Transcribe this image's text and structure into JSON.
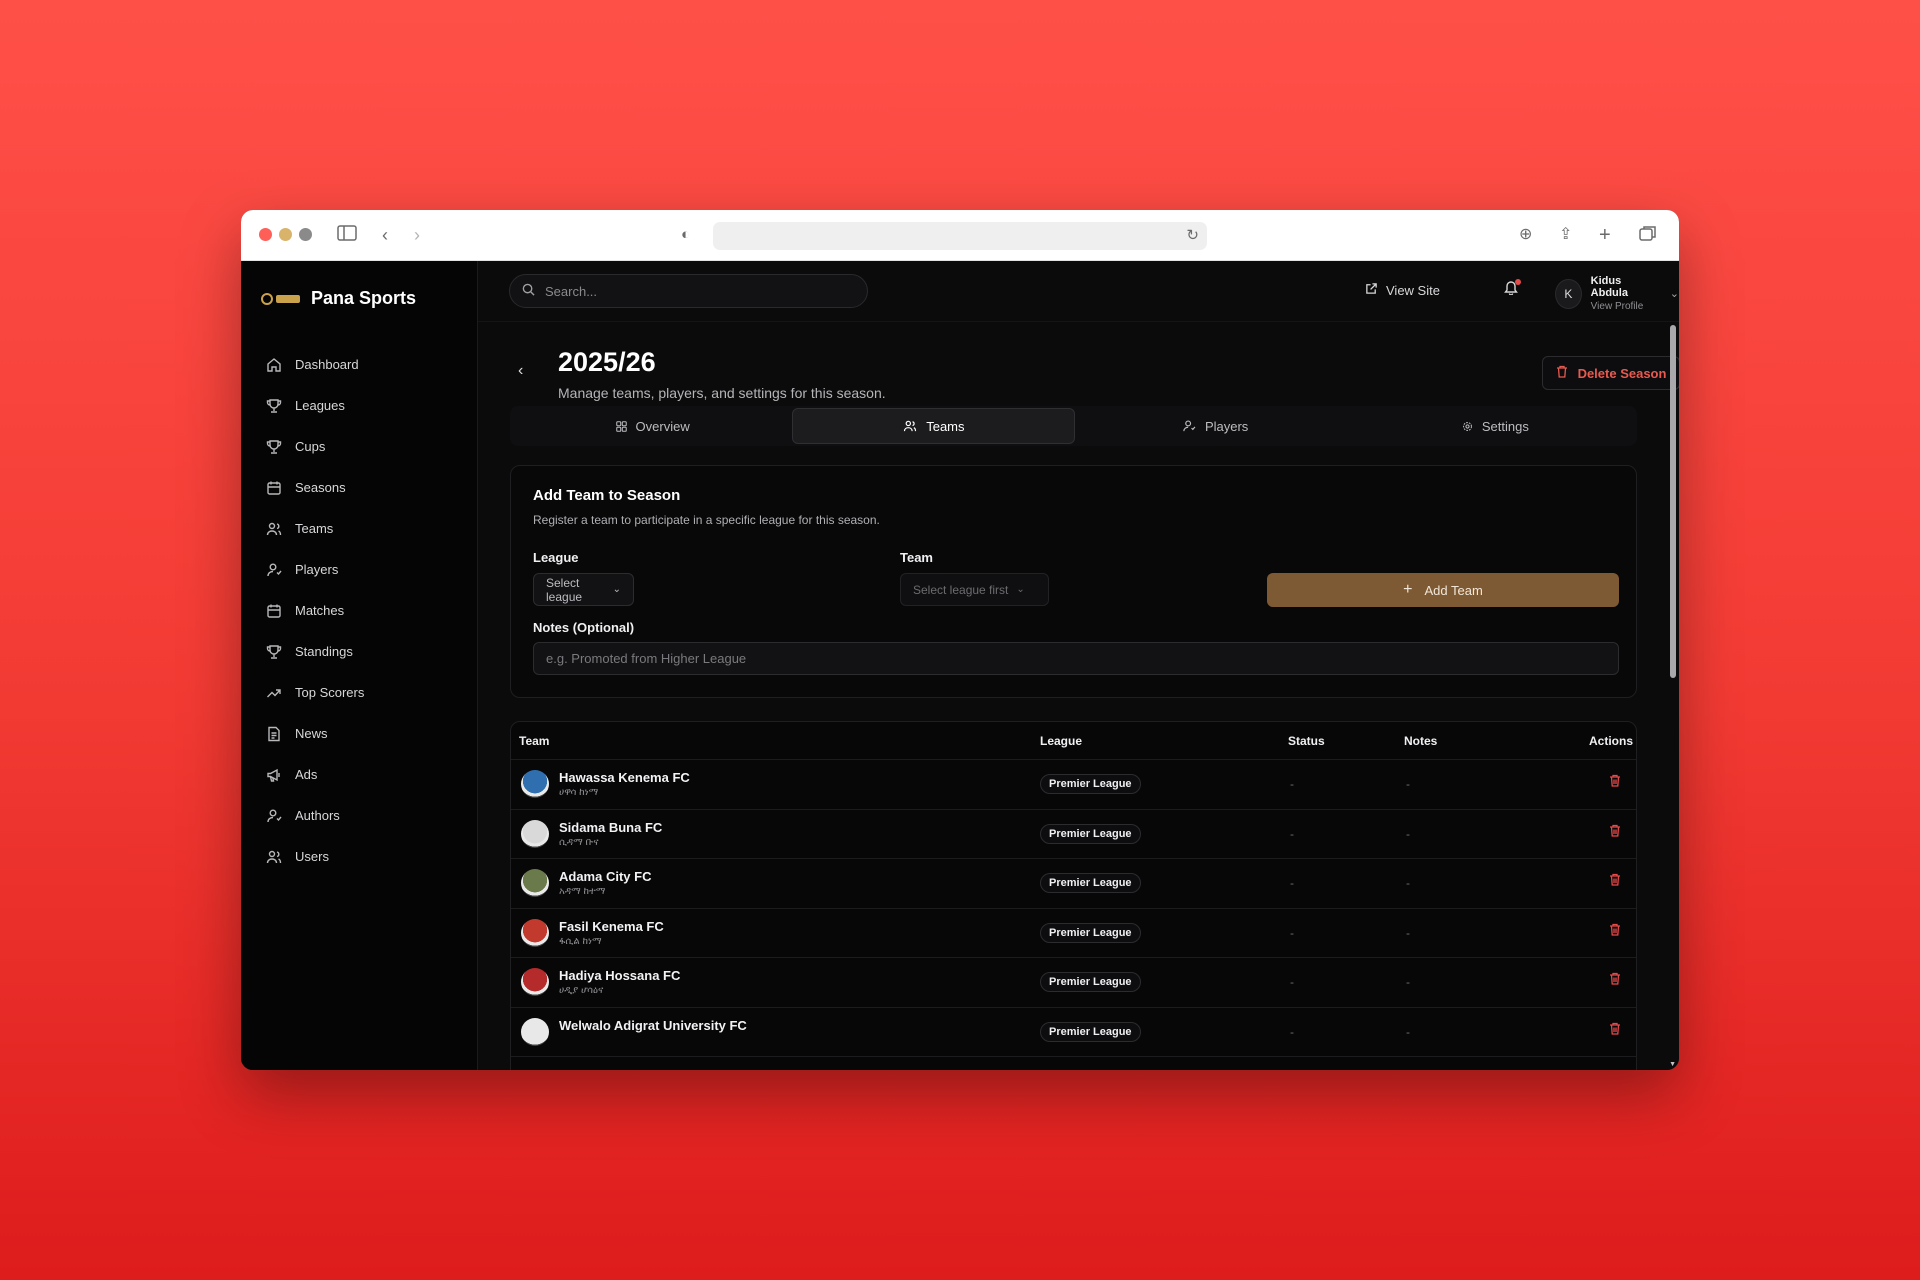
{
  "brand": {
    "name": "Pana Sports"
  },
  "sidebar": {
    "items": [
      {
        "label": "Dashboard",
        "icon": "home-icon"
      },
      {
        "label": "Leagues",
        "icon": "trophy-icon"
      },
      {
        "label": "Cups",
        "icon": "trophy-icon"
      },
      {
        "label": "Seasons",
        "icon": "calendar-icon"
      },
      {
        "label": "Teams",
        "icon": "users-icon"
      },
      {
        "label": "Players",
        "icon": "user-icon"
      },
      {
        "label": "Matches",
        "icon": "calendar-icon"
      },
      {
        "label": "Standings",
        "icon": "trophy-icon"
      },
      {
        "label": "Top Scorers",
        "icon": "trending-up-icon"
      },
      {
        "label": "News",
        "icon": "document-icon"
      },
      {
        "label": "Ads",
        "icon": "megaphone-icon"
      },
      {
        "label": "Authors",
        "icon": "user-icon"
      },
      {
        "label": "Users",
        "icon": "users-icon"
      }
    ]
  },
  "topbar": {
    "search_placeholder": "Search...",
    "view_site": "View Site",
    "profile_name": "Kidus Abdula",
    "profile_sub": "View Profile",
    "avatar_initial": "K"
  },
  "page": {
    "title": "2025/26",
    "subtitle": "Manage teams, players, and settings for this season.",
    "delete_label": "Delete Season"
  },
  "tabs": [
    {
      "label": "Overview",
      "icon": "grid-icon",
      "active": false
    },
    {
      "label": "Teams",
      "icon": "users-icon",
      "active": true
    },
    {
      "label": "Players",
      "icon": "user-icon",
      "active": false
    },
    {
      "label": "Settings",
      "icon": "gear-icon",
      "active": false
    }
  ],
  "add_team": {
    "title": "Add Team to Season",
    "subtitle": "Register a team to participate in a specific league for this season.",
    "league_label": "League",
    "league_placeholder": "Select league",
    "team_label": "Team",
    "team_placeholder": "Select league first",
    "add_button": "Add Team",
    "notes_label": "Notes (Optional)",
    "notes_placeholder": "e.g. Promoted from Higher League"
  },
  "table": {
    "headers": {
      "team": "Team",
      "league": "League",
      "status": "Status",
      "notes": "Notes",
      "actions": "Actions"
    },
    "rows": [
      {
        "name": "Hawassa Kenema FC",
        "amharic": "ሀዋሳ ከነማ",
        "league": "Premier League",
        "status": "-",
        "notes": "-",
        "crest_color": "#2f6fb0"
      },
      {
        "name": "Sidama Buna FC",
        "amharic": "ሲዳማ ቡና",
        "league": "Premier League",
        "status": "-",
        "notes": "-",
        "crest_color": "#d9d9d9"
      },
      {
        "name": "Adama City FC",
        "amharic": "አዳማ ከተማ",
        "league": "Premier League",
        "status": "-",
        "notes": "-",
        "crest_color": "#6b7a4a"
      },
      {
        "name": "Fasil Kenema FC",
        "amharic": "ፋሲል ከነማ",
        "league": "Premier League",
        "status": "-",
        "notes": "-",
        "crest_color": "#c23a2e"
      },
      {
        "name": "Hadiya Hossana FC",
        "amharic": "ሀዲያ ሆሳዕና",
        "league": "Premier League",
        "status": "-",
        "notes": "-",
        "crest_color": "#b52a2a"
      },
      {
        "name": "Welwalo Adigrat University FC",
        "amharic": "",
        "league": "Premier League",
        "status": "-",
        "notes": "-",
        "crest_color": "#e8e8e8"
      }
    ]
  }
}
